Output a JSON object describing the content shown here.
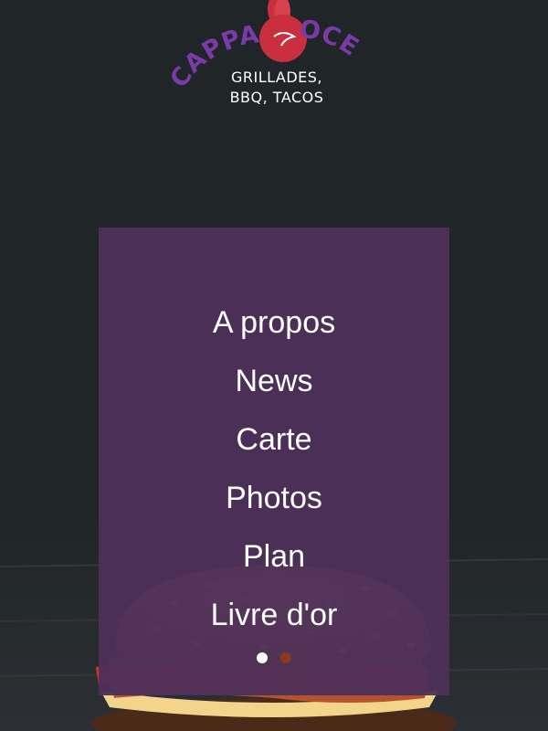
{
  "brand": {
    "name_left": "CAPPA",
    "name_right": "OCE",
    "tagline_line1": "GRILLADES,",
    "tagline_line2": "BBQ, TACOS",
    "colors": {
      "purple": "#7a3aa8",
      "red": "#c92f3e",
      "dark": "#202527"
    }
  },
  "menu": {
    "items": [
      {
        "label": "A propos"
      },
      {
        "label": "News"
      },
      {
        "label": "Carte"
      },
      {
        "label": "Photos"
      },
      {
        "label": "Plan"
      },
      {
        "label": "Livre d'or"
      }
    ],
    "panel_color": "#4e3058"
  },
  "slider": {
    "dots": [
      {
        "state": "active",
        "color": "#ffffff"
      },
      {
        "state": "inactive",
        "color": "#8b3a1a"
      }
    ]
  },
  "background": {
    "image": "burger-photo"
  }
}
